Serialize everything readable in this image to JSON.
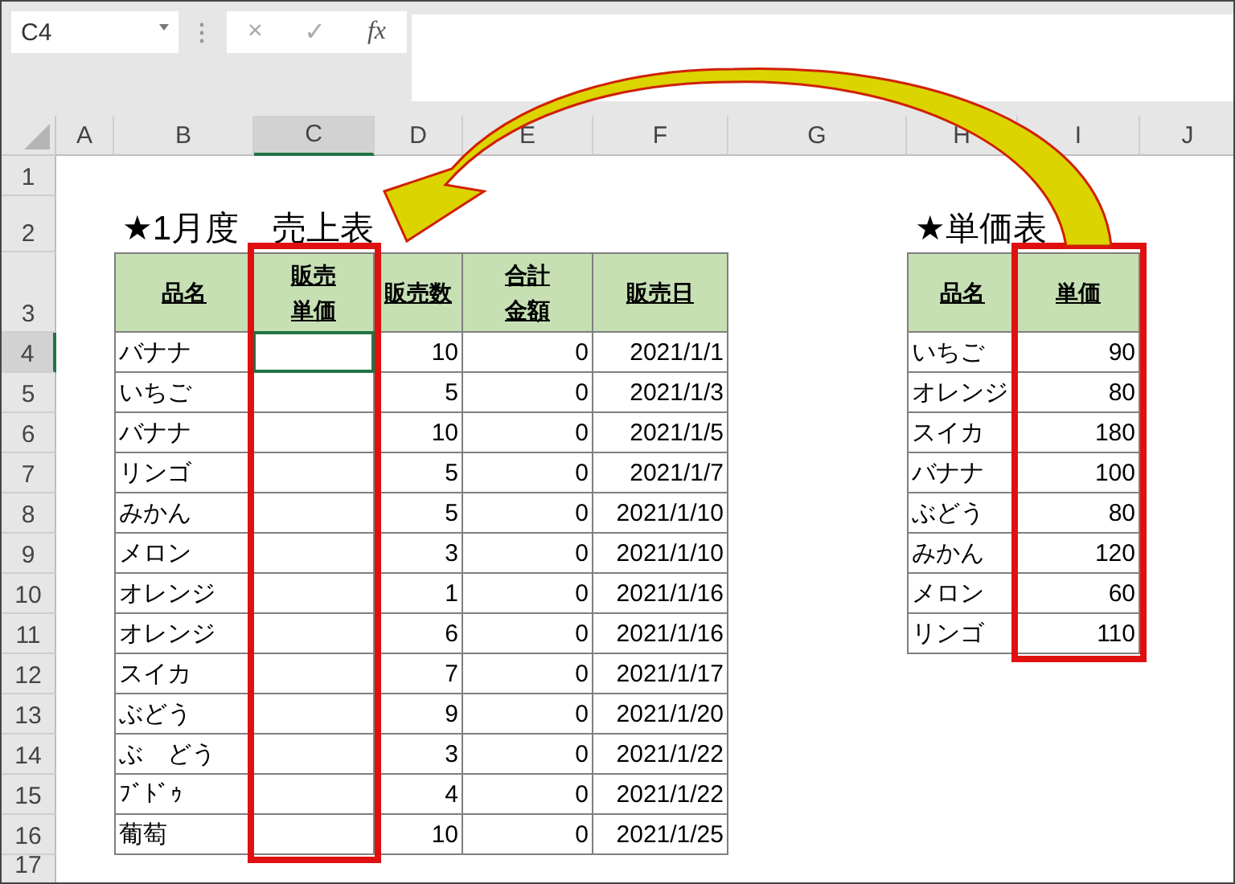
{
  "name_box": {
    "value": "C4"
  },
  "formula_buttons": [
    "×",
    "✓",
    "fx"
  ],
  "columns": [
    {
      "label": "A",
      "selected": false
    },
    {
      "label": "B",
      "selected": false
    },
    {
      "label": "C",
      "selected": true
    },
    {
      "label": "D",
      "selected": false
    },
    {
      "label": "E",
      "selected": false
    },
    {
      "label": "F",
      "selected": false
    },
    {
      "label": "G",
      "selected": false
    },
    {
      "label": "H",
      "selected": false
    },
    {
      "label": "I",
      "selected": false
    },
    {
      "label": "J",
      "selected": false
    }
  ],
  "rows": [
    {
      "label": "1",
      "selected": false
    },
    {
      "label": "2",
      "selected": false
    },
    {
      "label": "3",
      "selected": false
    },
    {
      "label": "4",
      "selected": true
    },
    {
      "label": "5",
      "selected": false
    },
    {
      "label": "6",
      "selected": false
    },
    {
      "label": "7",
      "selected": false
    },
    {
      "label": "8",
      "selected": false
    },
    {
      "label": "9",
      "selected": false
    },
    {
      "label": "10",
      "selected": false
    },
    {
      "label": "11",
      "selected": false
    },
    {
      "label": "12",
      "selected": false
    },
    {
      "label": "13",
      "selected": false
    },
    {
      "label": "14",
      "selected": false
    },
    {
      "label": "15",
      "selected": false
    },
    {
      "label": "16",
      "selected": false
    },
    {
      "label": "17",
      "selected": false
    }
  ],
  "sales_table": {
    "title": "★1月度　売上表",
    "columns": [
      [
        "品名"
      ],
      [
        "販売",
        "単価"
      ],
      [
        "販売数"
      ],
      [
        "合計",
        "金額"
      ],
      [
        "販売日"
      ]
    ],
    "rows": [
      {
        "item": "バナナ",
        "qty": "10",
        "total": "0",
        "date": "2021/1/1"
      },
      {
        "item": "いちご",
        "qty": "5",
        "total": "0",
        "date": "2021/1/3"
      },
      {
        "item": "バナナ",
        "qty": "10",
        "total": "0",
        "date": "2021/1/5"
      },
      {
        "item": "リンゴ",
        "qty": "5",
        "total": "0",
        "date": "2021/1/7"
      },
      {
        "item": "みかん",
        "qty": "5",
        "total": "0",
        "date": "2021/1/10"
      },
      {
        "item": "メロン",
        "qty": "3",
        "total": "0",
        "date": "2021/1/10"
      },
      {
        "item": "オレンジ",
        "qty": "1",
        "total": "0",
        "date": "2021/1/16"
      },
      {
        "item": "オレンジ",
        "qty": "6",
        "total": "0",
        "date": "2021/1/16"
      },
      {
        "item": "スイカ",
        "qty": "7",
        "total": "0",
        "date": "2021/1/17"
      },
      {
        "item": "ぶどう",
        "qty": "9",
        "total": "0",
        "date": "2021/1/20"
      },
      {
        "item": "ぶ　どう",
        "qty": "3",
        "total": "0",
        "date": "2021/1/22"
      },
      {
        "item": "ﾌﾞﾄﾞｩ",
        "qty": "4",
        "total": "0",
        "date": "2021/1/22"
      },
      {
        "item": "葡萄",
        "qty": "10",
        "total": "0",
        "date": "2021/1/25"
      }
    ]
  },
  "price_table": {
    "title": "★単価表",
    "columns": [
      [
        "品名"
      ],
      [
        "単価"
      ]
    ],
    "rows": [
      {
        "item": "いちご",
        "price": "90"
      },
      {
        "item": "オレンジ",
        "price": "80"
      },
      {
        "item": "スイカ",
        "price": "180"
      },
      {
        "item": "バナナ",
        "price": "100"
      },
      {
        "item": "ぶどう",
        "price": "80"
      },
      {
        "item": "みかん",
        "price": "120"
      },
      {
        "item": "メロン",
        "price": "60"
      },
      {
        "item": "リンゴ",
        "price": "110"
      }
    ]
  }
}
